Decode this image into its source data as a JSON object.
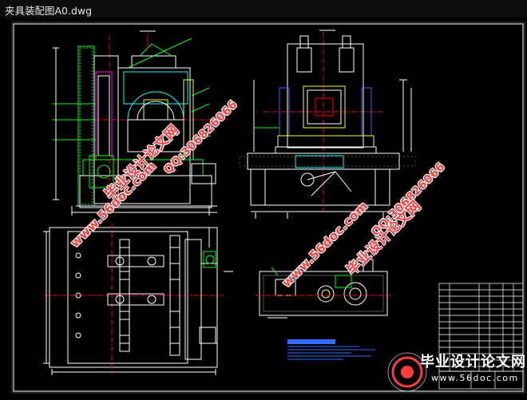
{
  "window": {
    "title": "夹具装配图A0.dwg"
  },
  "watermarks": {
    "site": "www.56doc.com",
    "qq": "QQ:306826066",
    "brand": "毕业设计论文网"
  },
  "banner": {
    "title": "毕业设计论文网",
    "url": "www.56doc.com"
  },
  "colors": {
    "background": "#000000",
    "lines_white": "#ffffff",
    "lines_cyan": "#00ffff",
    "lines_green": "#00ff00",
    "lines_yellow": "#ffff00",
    "lines_red": "#ff0000",
    "lines_blue": "#2f6bff",
    "lines_magenta": "#ff00ff"
  }
}
